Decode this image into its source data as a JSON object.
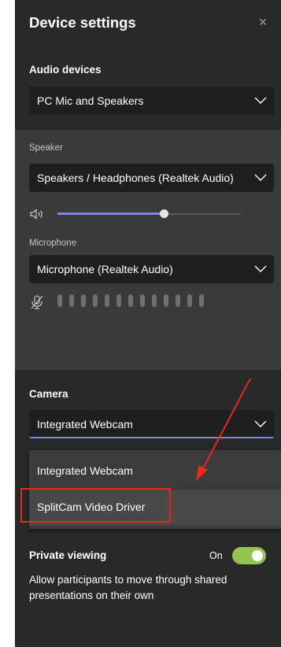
{
  "header": {
    "title": "Device settings",
    "close_label": "×"
  },
  "audio": {
    "section_label": "Audio devices",
    "device_value": "PC Mic and Speakers",
    "speaker": {
      "label": "Speaker",
      "value": "Speakers / Headphones (Realtek Audio)",
      "volume_fraction": 0.58
    },
    "microphone": {
      "label": "Microphone",
      "value": "Microphone (Realtek Audio)",
      "level_bars": 13
    }
  },
  "camera": {
    "section_label": "Camera",
    "selected_value": "Integrated Webcam",
    "options": [
      "Integrated Webcam",
      "SplitCam Video Driver"
    ]
  },
  "private_viewing": {
    "label": "Private viewing",
    "state_label": "On",
    "enabled": true,
    "description": "Allow participants to move through shared presentations on their own"
  },
  "colors": {
    "panel_bg": "#292929",
    "sub_bg": "#3a3a3a",
    "accent": "#7b83eb",
    "toggle_on": "#92c353",
    "annotation": "#e8271d"
  }
}
